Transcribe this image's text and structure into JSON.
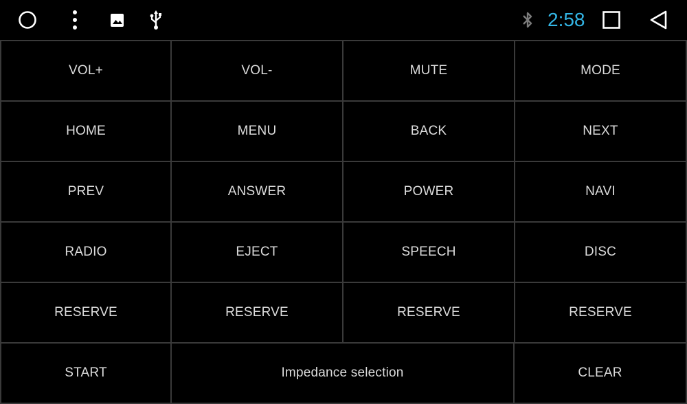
{
  "status_bar": {
    "icons": [
      "home-circle-icon",
      "more-vert-icon",
      "image-icon",
      "usb-icon"
    ],
    "right_icons": [
      "bluetooth-icon",
      "recents-square-icon",
      "back-triangle-icon"
    ],
    "time": "2:58",
    "time_color": "#33b5e5"
  },
  "keys": [
    {
      "label": "VOL+"
    },
    {
      "label": "VOL-"
    },
    {
      "label": "MUTE"
    },
    {
      "label": "MODE"
    },
    {
      "label": "HOME"
    },
    {
      "label": "MENU"
    },
    {
      "label": "BACK"
    },
    {
      "label": "NEXT"
    },
    {
      "label": "PREV"
    },
    {
      "label": "ANSWER"
    },
    {
      "label": "POWER"
    },
    {
      "label": "NAVI"
    },
    {
      "label": "RADIO"
    },
    {
      "label": "EJECT"
    },
    {
      "label": "SPEECH"
    },
    {
      "label": "DISC"
    },
    {
      "label": "RESERVE"
    },
    {
      "label": "RESERVE"
    },
    {
      "label": "RESERVE"
    },
    {
      "label": "RESERVE"
    },
    {
      "label": "START"
    },
    {
      "label": "Impedance selection"
    },
    {
      "label": "CLEAR"
    }
  ]
}
